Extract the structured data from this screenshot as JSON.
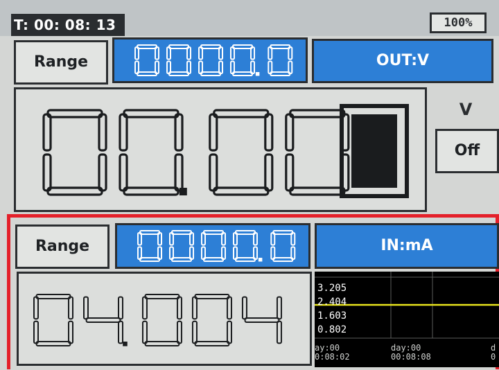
{
  "status_bar": {
    "timer": "T: 00: 08: 13",
    "battery": "100%"
  },
  "output_channel": {
    "range_label": "Range",
    "setpoint": "0000.0",
    "mode_label": "OUT:V",
    "reading": "00.00",
    "unit": "V",
    "toggle_label": "Off"
  },
  "input_channel": {
    "range_label": "Range",
    "setpoint": "0000.0",
    "mode_label": "IN:mA",
    "reading": "04.004"
  },
  "trend_graph": {
    "y_labels": [
      "3.205",
      "2.404",
      "1.603",
      "0.802"
    ],
    "x_labels": [
      {
        "day": "ay:00",
        "time": "0:08:02"
      },
      {
        "day": "day:00",
        "time": "00:08:08"
      },
      {
        "day": "d",
        "time": "0"
      }
    ],
    "trace_value": 2.404,
    "y_range": [
      0.802,
      3.205
    ]
  },
  "colors": {
    "accent_blue": "#2d7fd6",
    "highlight_red": "#e4202a",
    "trace_yellow": "#e8e41c",
    "segment_dark": "#1a1c1e"
  }
}
